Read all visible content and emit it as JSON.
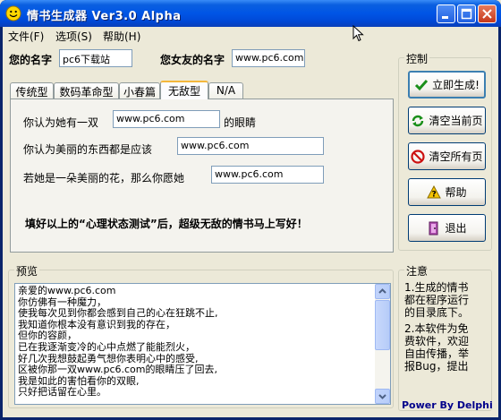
{
  "window": {
    "title": "情书生成器 Ver3.0 Alpha"
  },
  "menu": [
    {
      "label": "文件(F)"
    },
    {
      "label": "选项(S)"
    },
    {
      "label": "帮助(H)"
    }
  ],
  "names": {
    "my_label": "您的名字",
    "my_value": "pc6下载站",
    "her_label": "您女友的名字",
    "her_value": "www.pc6.com"
  },
  "tabs": [
    {
      "label": "传统型"
    },
    {
      "label": "数码革命型"
    },
    {
      "label": "小春篇"
    },
    {
      "label": "无敌型",
      "active": true
    },
    {
      "label": "N/A"
    }
  ],
  "questions": {
    "q1_prefix": "你认为她有一双",
    "q1_value": "www.pc6.com",
    "q1_suffix": "的眼睛",
    "q2_prefix": "你认为美丽的东西都是应该",
    "q2_value": "www.pc6.com",
    "q3_prefix": "若她是一朵美丽的花，那么你愿她",
    "q3_value": "www.pc6.com",
    "promo": "填好以上的“心理状态测试”后，超级无敌的情书马上写好！"
  },
  "control": {
    "title": "控制",
    "generate": "立即生成!",
    "clear_page": "清空当前页",
    "clear_all": "清空所有页",
    "help": "帮助",
    "exit": "退出"
  },
  "preview": {
    "title": "预览",
    "lines": [
      "亲爱的www.pc6.com",
      "你仿佛有一种魔力，",
      "使我每次见到你都会感到自己的心在狂跳不止,",
      "我知道你根本没有意识到我的存在，",
      "但你的容颜，",
      "已在我逐渐变冷的心中点燃了能能烈火，",
      "好几次我想鼓起勇气想你表明心中的感受,",
      "区被你那一双www.pc6.com的眼睛压了回去,",
      "我是如此的害怕看你的双眼,",
      "只好把话留在心里。"
    ]
  },
  "notes": {
    "title": "注意",
    "text": "1.生成的情书都在程序运行的目录底下。2.本软件为免费软件，欢迎自由传播，举报Bug，提出",
    "line1": "1.生成的情书",
    "line2": "都在程序运行",
    "line3": "的目录底下。",
    "line4": "2.本软件为免",
    "line5": "费软件，欢迎",
    "line6": "自由传播，举",
    "line7": "报Bug，提出",
    "power": "Power By Delphi"
  }
}
